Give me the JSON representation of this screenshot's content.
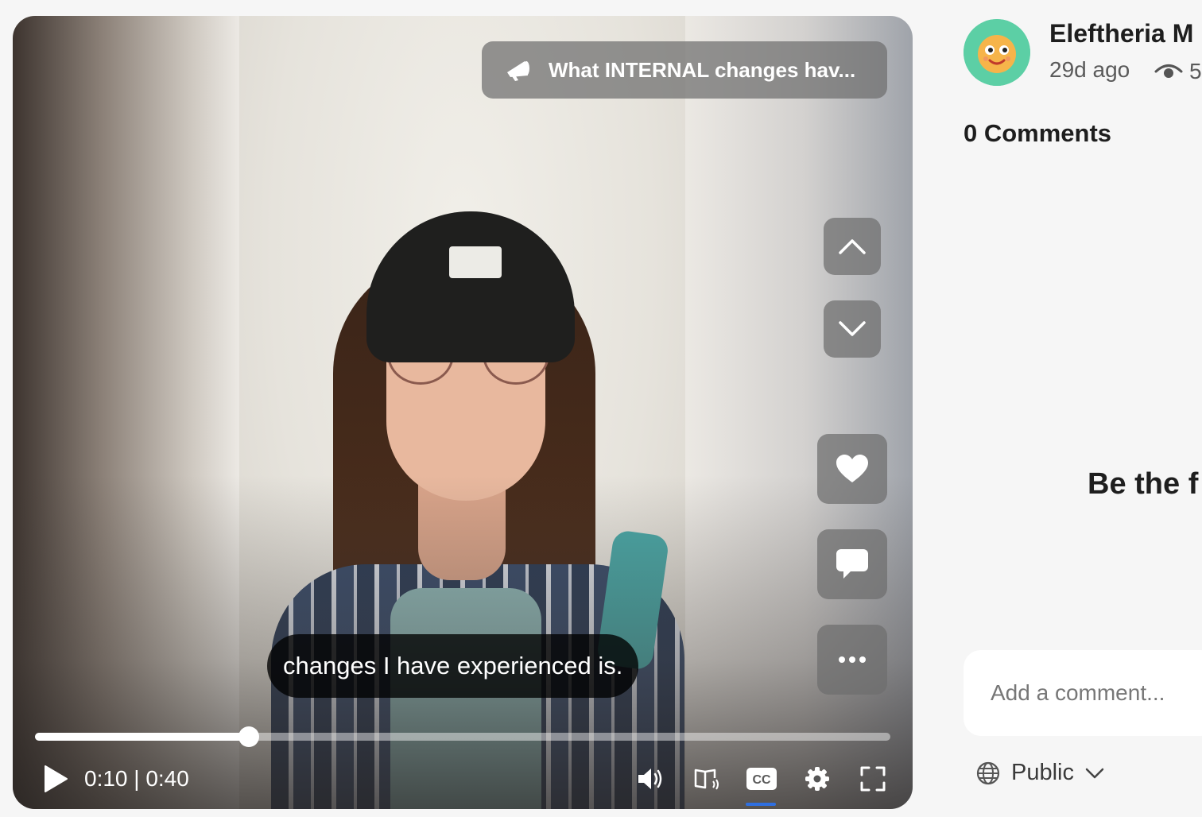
{
  "video": {
    "prompt_title": "What INTERNAL changes hav...",
    "caption": "changes I have experienced is.",
    "time_display": "0:10 | 0:40",
    "progress_fraction": 0.25
  },
  "post": {
    "author": "Eleftheria M",
    "age": "29d ago",
    "views_partial": "5"
  },
  "comments": {
    "title": "0 Comments",
    "empty_state_partial": "Be the f",
    "input_placeholder": "Add a comment...",
    "visibility": "Public"
  },
  "colors": {
    "accent_cc_underline": "#2f6fe0",
    "avatar_bg": "#5ccfa5"
  },
  "icons": [
    "megaphone-icon",
    "chevron-up-icon",
    "chevron-down-icon",
    "heart-icon",
    "comment-icon",
    "more-icon",
    "play-icon",
    "volume-icon",
    "audio-description-icon",
    "cc-icon",
    "settings-icon",
    "fullscreen-icon",
    "eye-icon",
    "globe-icon"
  ]
}
